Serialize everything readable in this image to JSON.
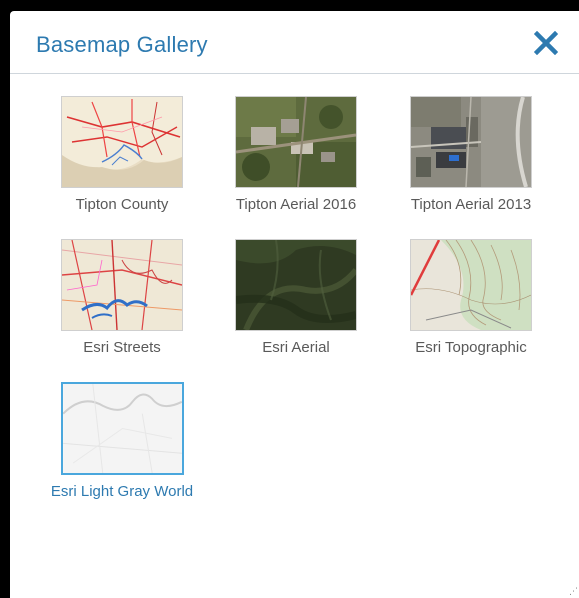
{
  "header": {
    "title": "Basemap Gallery",
    "close_icon": "close-icon"
  },
  "colors": {
    "accent": "#2d7ab0",
    "selected_border": "#4aa7dd",
    "label": "#595959"
  },
  "basemaps": [
    {
      "label": "Tipton County",
      "selected": false
    },
    {
      "label": "Tipton Aerial 2016",
      "selected": false
    },
    {
      "label": "Tipton Aerial 2013",
      "selected": false
    },
    {
      "label": "Esri Streets",
      "selected": false
    },
    {
      "label": "Esri Aerial",
      "selected": false
    },
    {
      "label": "Esri Topographic",
      "selected": false
    },
    {
      "label": "Esri Light Gray World",
      "selected": true
    }
  ]
}
